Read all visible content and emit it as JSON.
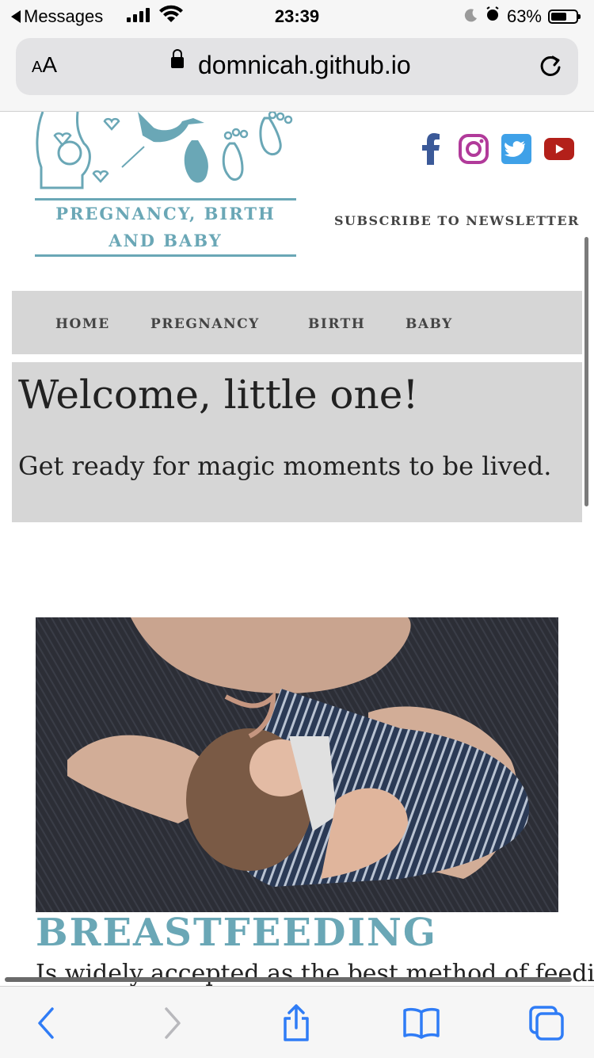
{
  "status_bar": {
    "back_app": "Messages",
    "time": "23:39",
    "battery_percent": "63%",
    "battery_level": 0.63
  },
  "browser": {
    "text_size_label": "AA",
    "url": "domnicah.github.io"
  },
  "site": {
    "logo_text": "PREGNANCY, BIRTH AND BABY",
    "social_icons": [
      "facebook-icon",
      "instagram-icon",
      "twitter-icon",
      "youtube-icon"
    ],
    "subscribe_label": "SUBSCRIBE TO NEWSLETTER",
    "nav": [
      "HOME",
      "PREGNANCY",
      "BIRTH",
      "BABY"
    ],
    "hero": {
      "title": "Welcome, little one!",
      "subtitle": "Get ready for magic moments to be lived."
    },
    "article": {
      "title": "BREASTFEEDING",
      "text": "Is widely accepted as the best method of feeding"
    }
  },
  "colors": {
    "brand_teal": "#6aa7b6",
    "facebook": "#3b5998",
    "instagram": "#b13a9a",
    "twitter": "#3fa1e8",
    "youtube": "#b3201a",
    "ios_blue": "#2f7cf6"
  },
  "toolbar_icons": [
    "back-icon",
    "forward-icon",
    "share-icon",
    "bookmarks-icon",
    "tabs-icon"
  ]
}
